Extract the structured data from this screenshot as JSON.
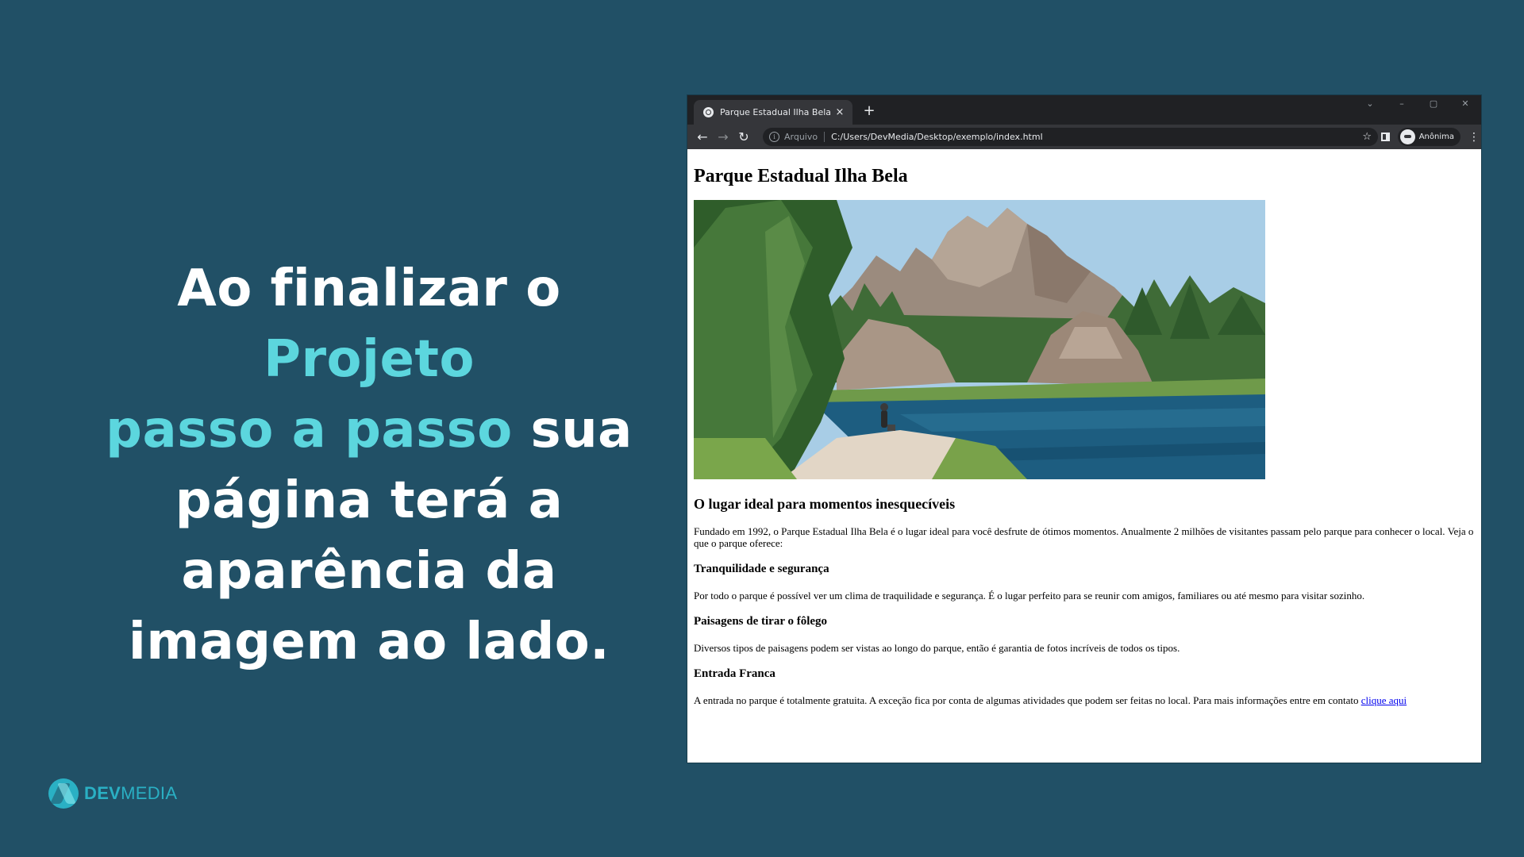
{
  "headline": {
    "line1_prefix": "Ao finalizar o ",
    "line1_accent": "Projeto",
    "line2_accent": "passo a passo",
    "line2_suffix": " sua",
    "line3": "página terá a",
    "line4": "aparência da",
    "line5": "imagem ao lado."
  },
  "colors": {
    "background": "#215066",
    "accent": "#5cd6de",
    "brand": "#2ab0c4"
  },
  "brand": {
    "logo_icon": "devmedia-logo-icon",
    "name_bold": "DEV",
    "name_light": "MEDIA"
  },
  "browser": {
    "tab": {
      "favicon": "globe-icon",
      "title": "Parque Estadual Ilha Bela",
      "close": "×"
    },
    "new_tab": "+",
    "window_controls": {
      "tab_search": "⌄",
      "minimize": "–",
      "maximize": "▢",
      "close": "✕"
    },
    "nav": {
      "back": "←",
      "forward": "→",
      "reload": "↻"
    },
    "omnibox": {
      "info_icon": "i",
      "scheme_label": "Arquivo",
      "url": "C:/Users/DevMedia/Desktop/exemplo/index.html",
      "star": "☆"
    },
    "profile_label": "Anônima",
    "menu": "⋮"
  },
  "page": {
    "title": "Parque Estadual Ilha Bela",
    "hero_image_alt": "lake-with-rocks-photo",
    "subtitle": "O lugar ideal para momentos inesquecíveis",
    "intro": "Fundado em 1992, o Parque Estadual Ilha Bela é o lugar ideal para você desfrute de ótimos momentos. Anualmente 2 milhões de visitantes passam pelo parque para conhecer o local. Veja o que o parque oferece:",
    "sections": [
      {
        "heading": "Tranquilidade e segurança",
        "text": "Por todo o parque é possível ver um clima de traquilidade e segurança. É o lugar perfeito para se reunir com amigos, familiares ou até mesmo para visitar sozinho."
      },
      {
        "heading": "Paisagens de tirar o fôlego",
        "text": "Diversos tipos de paisagens podem ser vistas ao longo do parque, então é garantia de fotos incríveis de todos os tipos."
      },
      {
        "heading": "Entrada Franca",
        "text": "A entrada no parque é totalmente gratuita. A exceção fica por conta de algumas atividades que podem ser feitas no local. Para mais informações entre em contato ",
        "link": "clique aqui"
      }
    ]
  }
}
